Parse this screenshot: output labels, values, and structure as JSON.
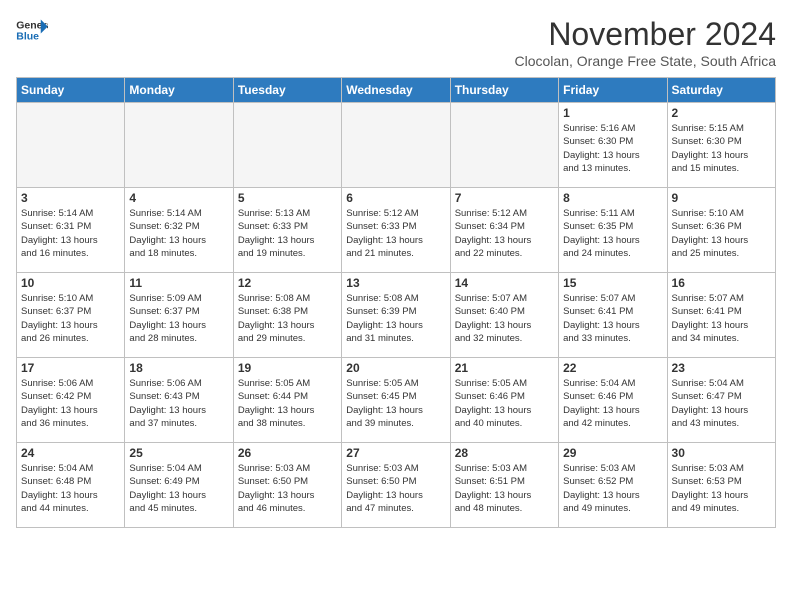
{
  "header": {
    "logo_line1": "General",
    "logo_line2": "Blue",
    "month": "November 2024",
    "location": "Clocolan, Orange Free State, South Africa"
  },
  "weekdays": [
    "Sunday",
    "Monday",
    "Tuesday",
    "Wednesday",
    "Thursday",
    "Friday",
    "Saturday"
  ],
  "weeks": [
    [
      {
        "day": "",
        "info": ""
      },
      {
        "day": "",
        "info": ""
      },
      {
        "day": "",
        "info": ""
      },
      {
        "day": "",
        "info": ""
      },
      {
        "day": "",
        "info": ""
      },
      {
        "day": "1",
        "info": "Sunrise: 5:16 AM\nSunset: 6:30 PM\nDaylight: 13 hours\nand 13 minutes."
      },
      {
        "day": "2",
        "info": "Sunrise: 5:15 AM\nSunset: 6:30 PM\nDaylight: 13 hours\nand 15 minutes."
      }
    ],
    [
      {
        "day": "3",
        "info": "Sunrise: 5:14 AM\nSunset: 6:31 PM\nDaylight: 13 hours\nand 16 minutes."
      },
      {
        "day": "4",
        "info": "Sunrise: 5:14 AM\nSunset: 6:32 PM\nDaylight: 13 hours\nand 18 minutes."
      },
      {
        "day": "5",
        "info": "Sunrise: 5:13 AM\nSunset: 6:33 PM\nDaylight: 13 hours\nand 19 minutes."
      },
      {
        "day": "6",
        "info": "Sunrise: 5:12 AM\nSunset: 6:33 PM\nDaylight: 13 hours\nand 21 minutes."
      },
      {
        "day": "7",
        "info": "Sunrise: 5:12 AM\nSunset: 6:34 PM\nDaylight: 13 hours\nand 22 minutes."
      },
      {
        "day": "8",
        "info": "Sunrise: 5:11 AM\nSunset: 6:35 PM\nDaylight: 13 hours\nand 24 minutes."
      },
      {
        "day": "9",
        "info": "Sunrise: 5:10 AM\nSunset: 6:36 PM\nDaylight: 13 hours\nand 25 minutes."
      }
    ],
    [
      {
        "day": "10",
        "info": "Sunrise: 5:10 AM\nSunset: 6:37 PM\nDaylight: 13 hours\nand 26 minutes."
      },
      {
        "day": "11",
        "info": "Sunrise: 5:09 AM\nSunset: 6:37 PM\nDaylight: 13 hours\nand 28 minutes."
      },
      {
        "day": "12",
        "info": "Sunrise: 5:08 AM\nSunset: 6:38 PM\nDaylight: 13 hours\nand 29 minutes."
      },
      {
        "day": "13",
        "info": "Sunrise: 5:08 AM\nSunset: 6:39 PM\nDaylight: 13 hours\nand 31 minutes."
      },
      {
        "day": "14",
        "info": "Sunrise: 5:07 AM\nSunset: 6:40 PM\nDaylight: 13 hours\nand 32 minutes."
      },
      {
        "day": "15",
        "info": "Sunrise: 5:07 AM\nSunset: 6:41 PM\nDaylight: 13 hours\nand 33 minutes."
      },
      {
        "day": "16",
        "info": "Sunrise: 5:07 AM\nSunset: 6:41 PM\nDaylight: 13 hours\nand 34 minutes."
      }
    ],
    [
      {
        "day": "17",
        "info": "Sunrise: 5:06 AM\nSunset: 6:42 PM\nDaylight: 13 hours\nand 36 minutes."
      },
      {
        "day": "18",
        "info": "Sunrise: 5:06 AM\nSunset: 6:43 PM\nDaylight: 13 hours\nand 37 minutes."
      },
      {
        "day": "19",
        "info": "Sunrise: 5:05 AM\nSunset: 6:44 PM\nDaylight: 13 hours\nand 38 minutes."
      },
      {
        "day": "20",
        "info": "Sunrise: 5:05 AM\nSunset: 6:45 PM\nDaylight: 13 hours\nand 39 minutes."
      },
      {
        "day": "21",
        "info": "Sunrise: 5:05 AM\nSunset: 6:46 PM\nDaylight: 13 hours\nand 40 minutes."
      },
      {
        "day": "22",
        "info": "Sunrise: 5:04 AM\nSunset: 6:46 PM\nDaylight: 13 hours\nand 42 minutes."
      },
      {
        "day": "23",
        "info": "Sunrise: 5:04 AM\nSunset: 6:47 PM\nDaylight: 13 hours\nand 43 minutes."
      }
    ],
    [
      {
        "day": "24",
        "info": "Sunrise: 5:04 AM\nSunset: 6:48 PM\nDaylight: 13 hours\nand 44 minutes."
      },
      {
        "day": "25",
        "info": "Sunrise: 5:04 AM\nSunset: 6:49 PM\nDaylight: 13 hours\nand 45 minutes."
      },
      {
        "day": "26",
        "info": "Sunrise: 5:03 AM\nSunset: 6:50 PM\nDaylight: 13 hours\nand 46 minutes."
      },
      {
        "day": "27",
        "info": "Sunrise: 5:03 AM\nSunset: 6:50 PM\nDaylight: 13 hours\nand 47 minutes."
      },
      {
        "day": "28",
        "info": "Sunrise: 5:03 AM\nSunset: 6:51 PM\nDaylight: 13 hours\nand 48 minutes."
      },
      {
        "day": "29",
        "info": "Sunrise: 5:03 AM\nSunset: 6:52 PM\nDaylight: 13 hours\nand 49 minutes."
      },
      {
        "day": "30",
        "info": "Sunrise: 5:03 AM\nSunset: 6:53 PM\nDaylight: 13 hours\nand 49 minutes."
      }
    ]
  ]
}
